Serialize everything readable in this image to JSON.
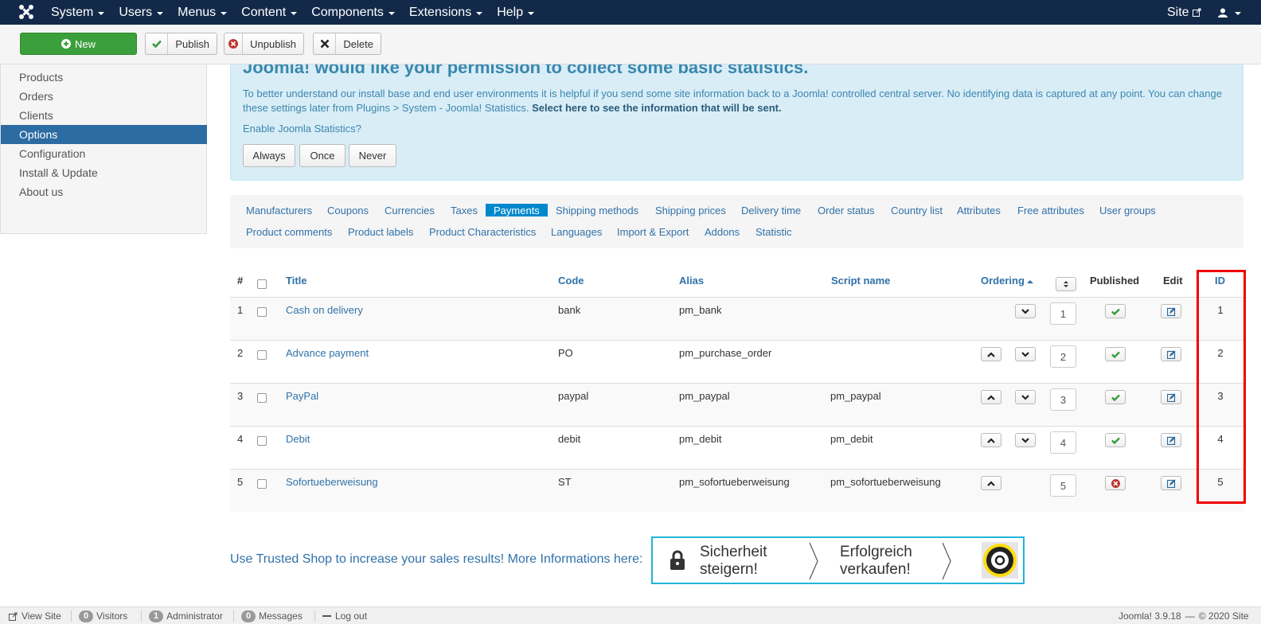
{
  "navbar": {
    "menu": [
      "System",
      "Users",
      "Menus",
      "Content",
      "Components",
      "Extensions",
      "Help"
    ],
    "site_label": "Site"
  },
  "toolbar": {
    "new_label": "New",
    "publish_label": "Publish",
    "unpublish_label": "Unpublish",
    "delete_label": "Delete"
  },
  "sidebar": {
    "items": [
      "Products",
      "Orders",
      "Clients",
      "Options",
      "Configuration",
      "Install & Update",
      "About us"
    ],
    "active": "Options"
  },
  "stats_message": {
    "heading": "Joomla! would like your permission to collect some basic statistics.",
    "body": "To better understand our install base and end user environments it is helpful if you send some site information back to a Joomla! controlled central server. No identifying data is captured at any point. You can change these settings later from Plugins > System - Joomla! Statistics.",
    "link": "Select here to see the information that will be sent.",
    "question": "Enable Joomla Statistics?",
    "buttons": [
      "Always",
      "Once",
      "Never"
    ]
  },
  "tabs": {
    "row1": [
      "Manufacturers",
      "Coupons",
      "Currencies",
      "Taxes",
      "Payments",
      "Shipping methods",
      "Shipping prices",
      "Delivery time",
      "Order status",
      "Country list",
      "Attributes",
      "Free attributes",
      "User groups"
    ],
    "row2": [
      "Product comments",
      "Product labels",
      "Product Characteristics",
      "Languages",
      "Import & Export",
      "Addons",
      "Statistic"
    ],
    "active": "Payments"
  },
  "table": {
    "headers": {
      "num": "#",
      "title": "Title",
      "code": "Code",
      "alias": "Alias",
      "script": "Script name",
      "ordering": "Ordering",
      "published": "Published",
      "edit": "Edit",
      "id": "ID"
    },
    "rows": [
      {
        "num": "1",
        "title": "Cash on delivery",
        "code": "bank",
        "alias": "pm_bank",
        "script": "",
        "order": "1",
        "published": true,
        "id": "1"
      },
      {
        "num": "2",
        "title": "Advance payment",
        "code": "PO",
        "alias": "pm_purchase_order",
        "script": "",
        "order": "2",
        "published": true,
        "id": "2"
      },
      {
        "num": "3",
        "title": "PayPal",
        "code": "paypal",
        "alias": "pm_paypal",
        "script": "pm_paypal",
        "order": "3",
        "published": true,
        "id": "3"
      },
      {
        "num": "4",
        "title": "Debit",
        "code": "debit",
        "alias": "pm_debit",
        "script": "pm_debit",
        "order": "4",
        "published": true,
        "id": "4"
      },
      {
        "num": "5",
        "title": "Sofortueberweisung",
        "code": "ST",
        "alias": "pm_sofortueberweisung",
        "script": "pm_sofortueberweisung",
        "order": "5",
        "published": false,
        "id": "5"
      }
    ]
  },
  "trusted": {
    "text": "Use Trusted Shop to increase your sales results! More Informations here:",
    "banner_line1a": "Sicherheit",
    "banner_line1b": "steigern!",
    "banner_line2a": "Erfolgreich",
    "banner_line2b": "verkaufen!"
  },
  "statusbar": {
    "view_site": "View Site",
    "visitors_count": "0",
    "visitors": "Visitors",
    "admin_count": "1",
    "admin": "Administrator",
    "messages_count": "0",
    "messages": "Messages",
    "logout": "Log out",
    "version": "Joomla! 3.9.18",
    "copyright": "© 2020 Site"
  }
}
